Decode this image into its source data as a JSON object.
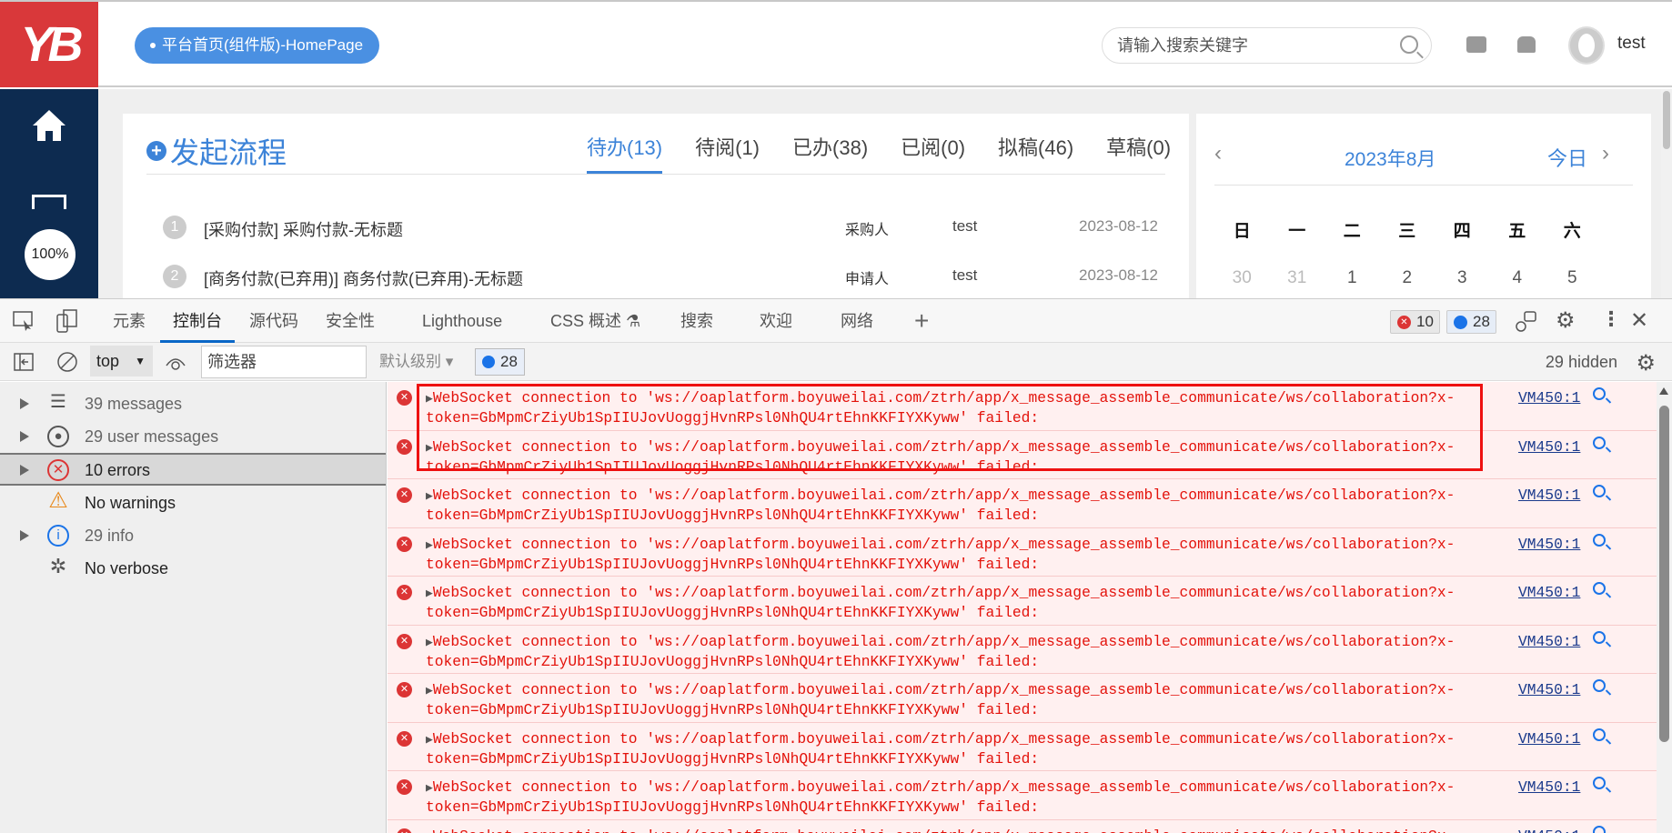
{
  "header": {
    "logo": "YB",
    "home_pill": "平台首页(组件版)-HomePage",
    "search_placeholder": "请输入搜索关键字",
    "username": "test"
  },
  "sidebar": {
    "zoom": "100%"
  },
  "workflow": {
    "start_label": "发起流程",
    "tabs": [
      "待办(13)",
      "待阅(1)",
      "已办(38)",
      "已阅(0)",
      "拟稿(46)",
      "草稿(0)"
    ],
    "rows": [
      {
        "num": "1",
        "title": "[采购付款] 采购付款-无标题",
        "role": "采购人",
        "user": "test",
        "date": "2023-08-12"
      },
      {
        "num": "2",
        "title": "[商务付款(已弃用)] 商务付款(已弃用)-无标题",
        "role": "申请人",
        "user": "test",
        "date": "2023-08-12"
      }
    ]
  },
  "calendar": {
    "month": "2023年8月",
    "today": "今日",
    "prev": "‹",
    "next": "›",
    "weekdays": [
      "日",
      "一",
      "二",
      "三",
      "四",
      "五",
      "六"
    ],
    "days": [
      "30",
      "31",
      "1",
      "2",
      "3",
      "4",
      "5"
    ]
  },
  "devtools": {
    "tabs": [
      "元素",
      "控制台",
      "源代码",
      "安全性",
      "Lighthouse",
      "CSS 概述 ⚗",
      "搜索",
      "欢迎",
      "网络"
    ],
    "error_count": "10",
    "info_count": "28",
    "toolbar": {
      "context": "top",
      "filter_placeholder": "筛选器",
      "level": "默认级别 ▾",
      "msg_count": "28",
      "hidden": "29 hidden"
    },
    "sidebar": [
      {
        "label": "39 messages",
        "icon": "list-icon"
      },
      {
        "label": "29 user messages",
        "icon": "user-icon"
      },
      {
        "label": "10 errors",
        "icon": "error-icon"
      },
      {
        "label": "No warnings",
        "icon": "warning-icon"
      },
      {
        "label": "29 info",
        "icon": "info-icon"
      },
      {
        "label": "No verbose",
        "icon": "bug-icon"
      }
    ],
    "messages": {
      "line1": "WebSocket connection to 'ws://oaplatform.boyuweilai.com/ztrh/app/x_message_assemble_communicate/ws/collaboration?x-",
      "line2": "token=GbMpmCrZiyUb1SpIIUJovUoggjHvnRPsl0NhQU4rtEhnKKFIYXKyww' failed:",
      "source": "VM450:1",
      "count": 10
    }
  }
}
